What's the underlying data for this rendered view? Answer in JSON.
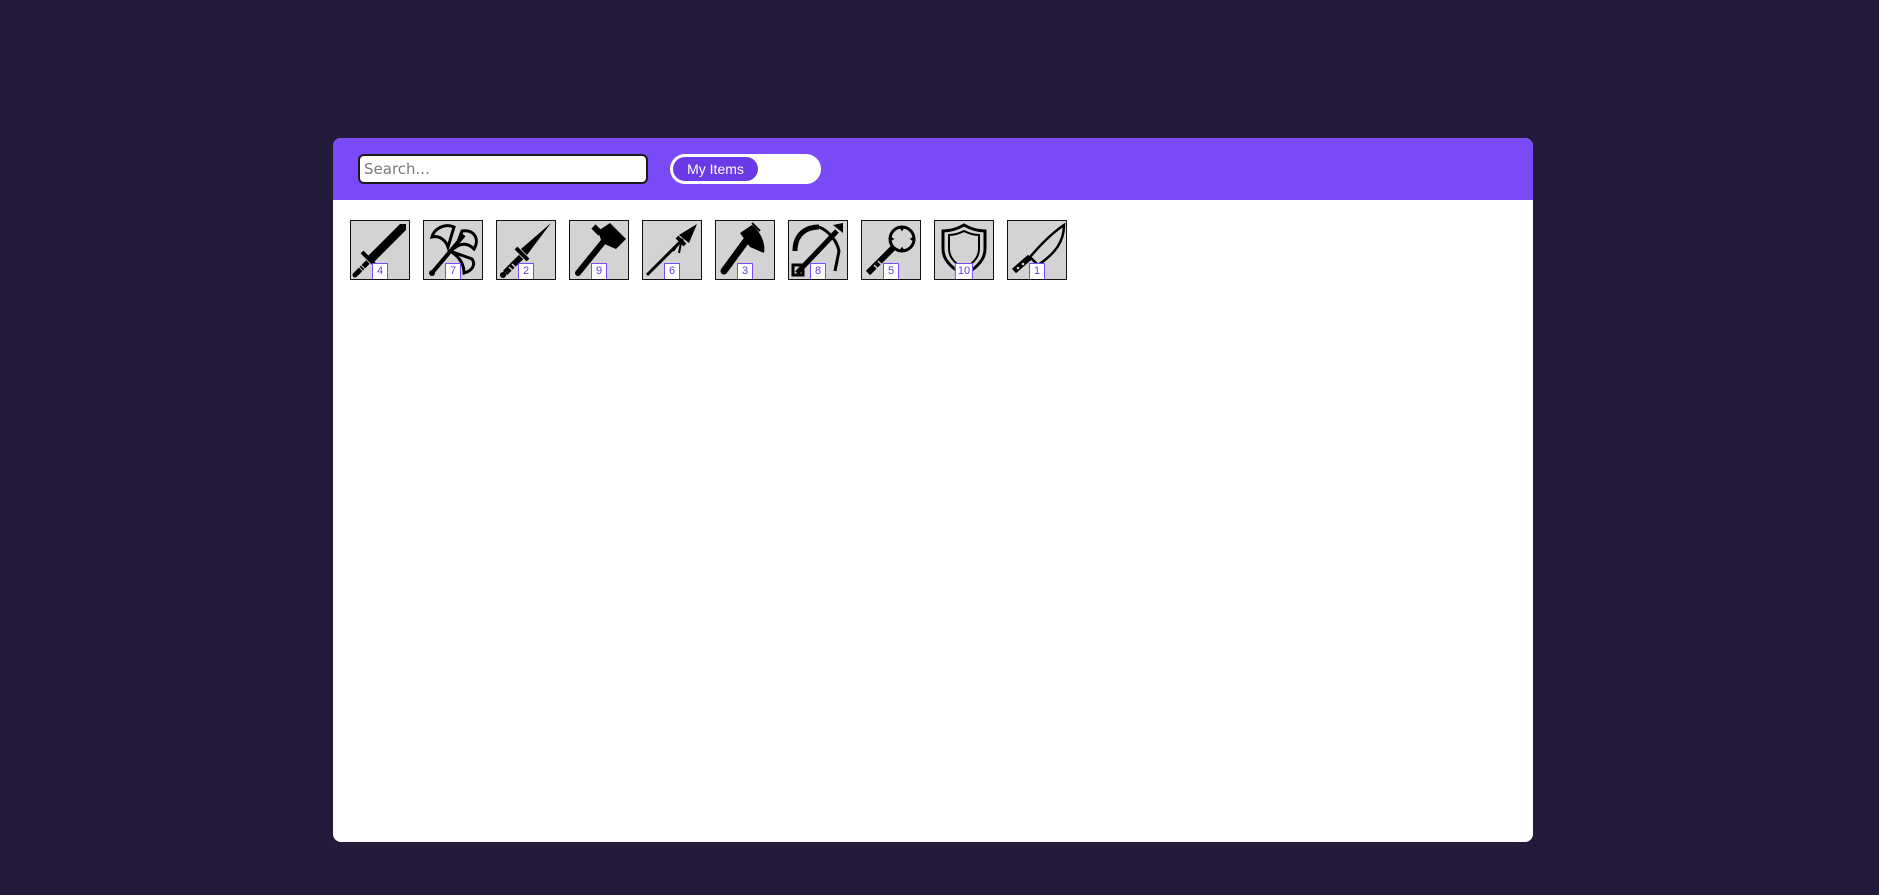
{
  "search": {
    "placeholder": "Search..."
  },
  "toggle": {
    "active_label": "My Items"
  },
  "items": [
    {
      "icon": "sword-icon",
      "count": "4"
    },
    {
      "icon": "battle-axe-icon",
      "count": "7"
    },
    {
      "icon": "dagger-icon",
      "count": "2"
    },
    {
      "icon": "hammer-icon",
      "count": "9"
    },
    {
      "icon": "spear-icon",
      "count": "6"
    },
    {
      "icon": "axe-icon",
      "count": "3"
    },
    {
      "icon": "crossbow-icon",
      "count": "8"
    },
    {
      "icon": "mace-icon",
      "count": "5"
    },
    {
      "icon": "shield-icon",
      "count": "10"
    },
    {
      "icon": "machete-icon",
      "count": "1"
    }
  ],
  "colors": {
    "background": "#231b39",
    "toolbar": "#7b4af7",
    "accent": "#6a3ae6",
    "tile": "#d3d3d3"
  }
}
